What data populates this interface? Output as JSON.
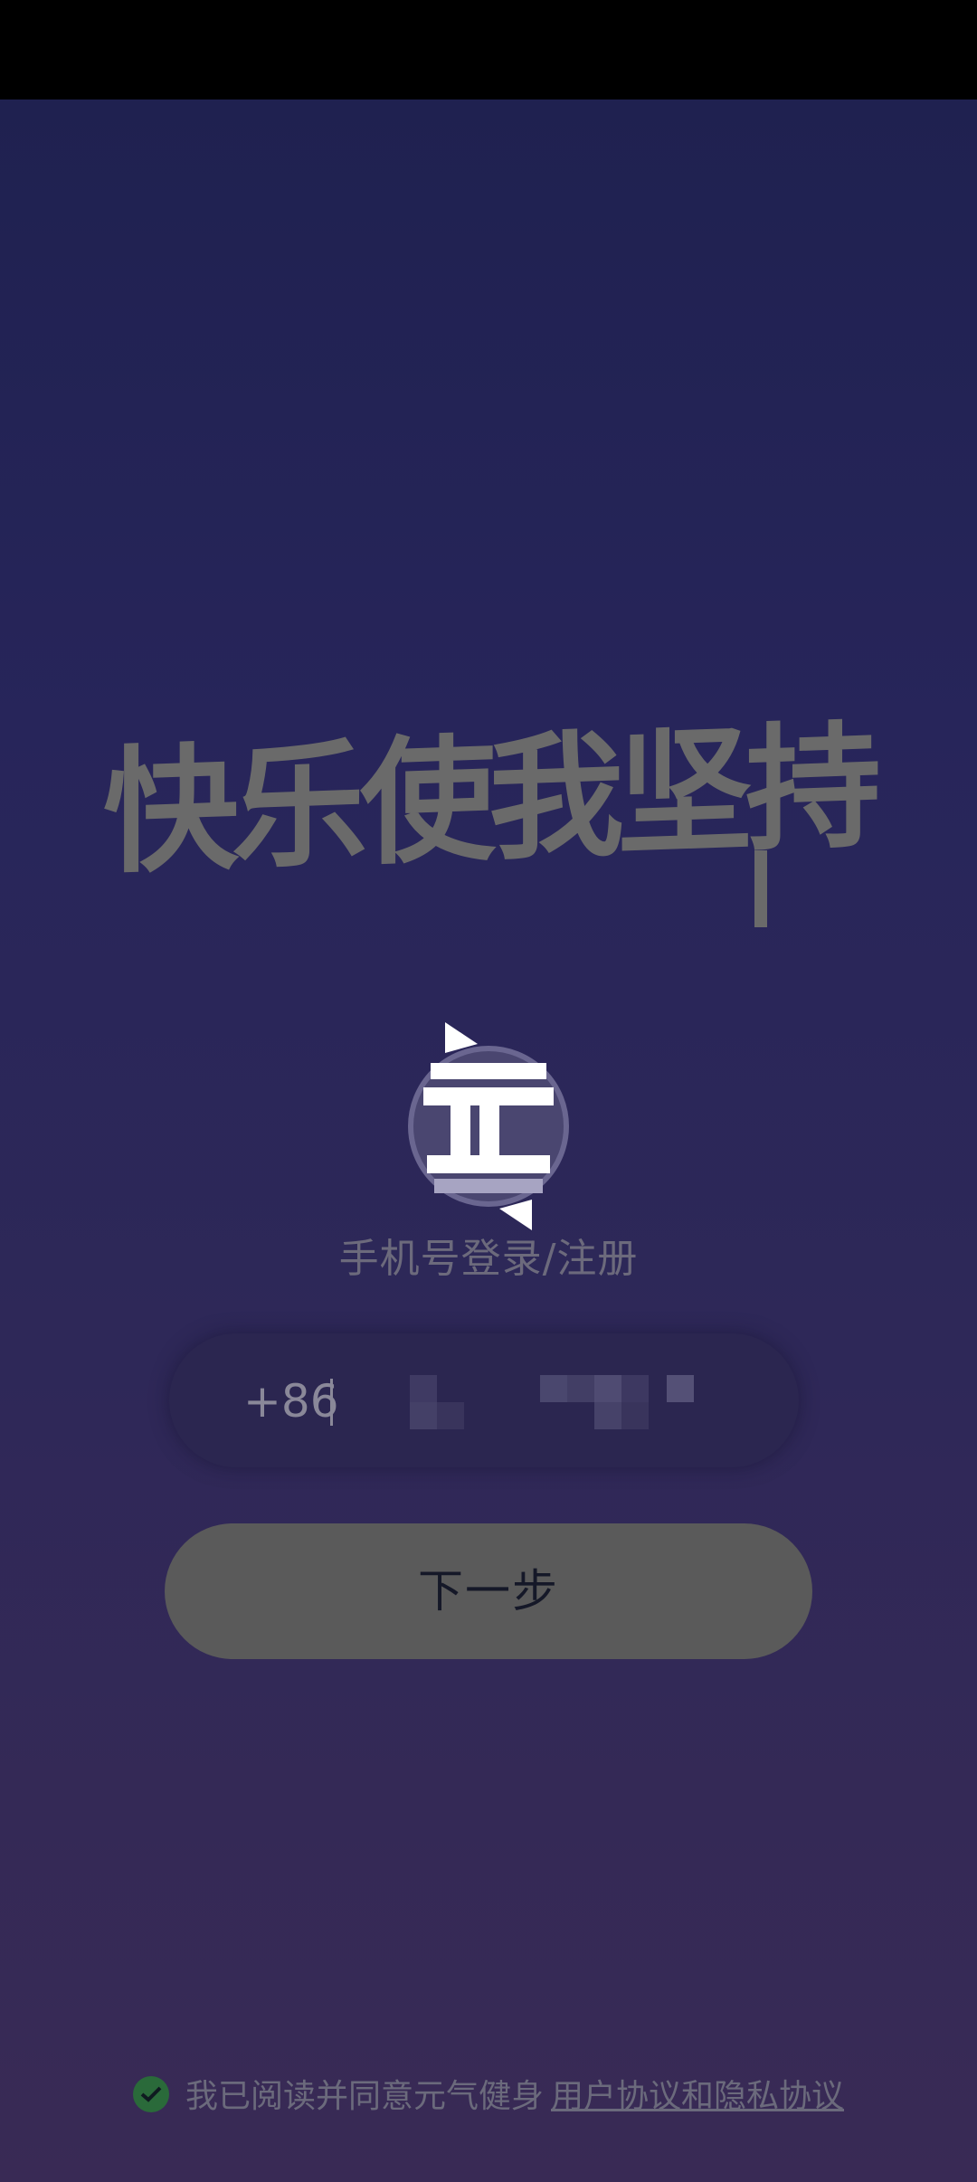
{
  "slogan": "快乐使我坚持",
  "logo": {
    "icon": "yuanqi-logo"
  },
  "login": {
    "title": "手机号登录/注册",
    "country_code": "+86",
    "phone_value": ""
  },
  "actions": {
    "next_label": "下一步"
  },
  "agreement": {
    "checked": true,
    "text": "我已阅读并同意元气健身",
    "link_label": "用户协议和隐私协议"
  },
  "colors": {
    "background_top": "#1f2150",
    "background_bottom": "#392a55",
    "button": "#5a5a5a",
    "check": "#2a6a3a"
  }
}
